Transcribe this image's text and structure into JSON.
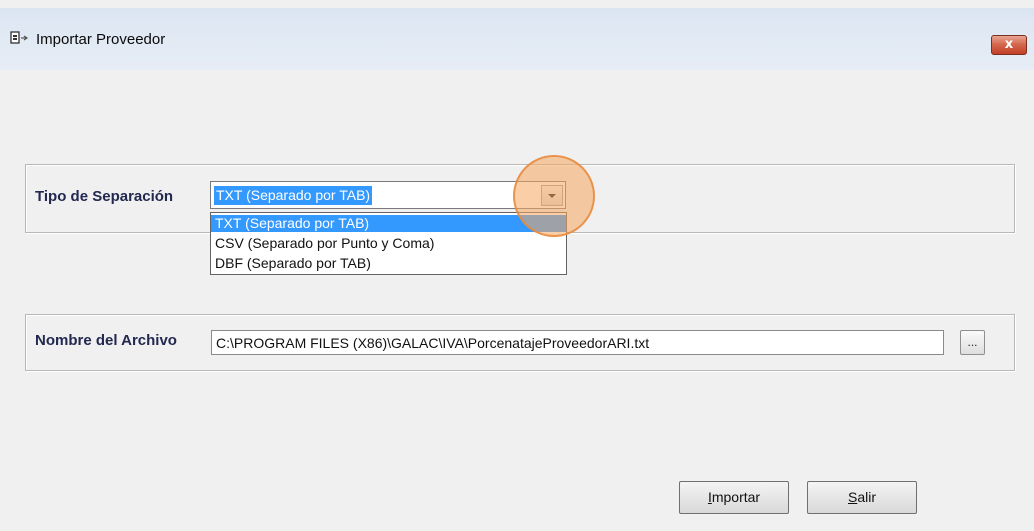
{
  "window": {
    "title": "Importar Proveedor",
    "close_label": "x"
  },
  "separation": {
    "label": "Tipo de Separación",
    "selected": "TXT (Separado por TAB)",
    "options": [
      "TXT (Separado por TAB)",
      "CSV (Separado por Punto y Coma)",
      "DBF (Separado por TAB)"
    ]
  },
  "file": {
    "label": "Nombre del Archivo",
    "value": "C:\\PROGRAM FILES (X86)\\GALAC\\IVA\\PorcenatajeProveedorARI.txt",
    "browse_label": "..."
  },
  "buttons": {
    "import_hotkey": "I",
    "import_rest": "mportar",
    "exit_hotkey": "S",
    "exit_rest": "alir"
  },
  "colors": {
    "selection": "#3399ff",
    "label_text": "#22284f",
    "highlight": "#f6a860"
  },
  "icons": {
    "app": "window-icon",
    "close": "close-icon",
    "dropdown": "chevron-down-icon"
  }
}
